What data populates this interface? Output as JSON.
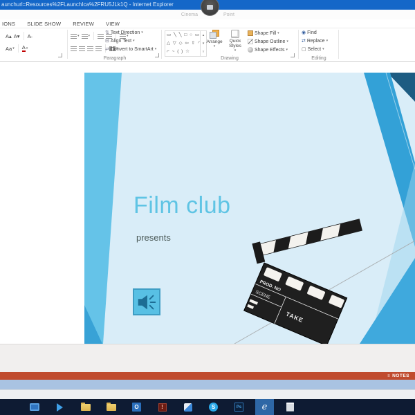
{
  "window": {
    "title": "aunchurl=Resources%2FLaunchIca%2FRU5JLk1Q - Internet Explorer"
  },
  "app_header": {
    "doc_title_left": "Cinema",
    "doc_title_right": "Point"
  },
  "ribbon": {
    "tabs": [
      {
        "label": "IONS"
      },
      {
        "label": "SLIDE SHOW"
      },
      {
        "label": "REVIEW"
      },
      {
        "label": "VIEW"
      }
    ],
    "font_group": {
      "grow": "A▴",
      "shrink": "A▾",
      "clear": "A̶",
      "change_case": "Aa",
      "font_color": "A"
    },
    "paragraph_group": {
      "label": "Paragraph",
      "text_direction": "Text Direction",
      "align_text": "Align Text",
      "smartart": "Convert to SmartArt"
    },
    "drawing_group": {
      "label": "Drawing",
      "shape_row_1": "▭ ╲ ╲ □ ○ ▭",
      "shape_row_2": "△ ▽ ◇ ⇦ ⇧ ◠",
      "shape_row_3": "⌐ ~ ( ) ☆",
      "arrange": "Arrange",
      "quick_styles": "Quick Styles",
      "shape_fill": "Shape Fill",
      "shape_outline": "Shape Outline",
      "shape_effects": "Shape Effects"
    },
    "editing_group": {
      "label": "Editing",
      "find": "Find",
      "replace": "Replace",
      "select": "Select"
    }
  },
  "slide": {
    "title": "Film club",
    "subtitle": "presents",
    "clapperboard": {
      "prod_no": "PROD. NO",
      "scene": "SCENE",
      "take": "TAKE"
    }
  },
  "status_bar": {
    "notes": "NOTES"
  },
  "taskbar": {
    "icons": [
      {
        "name": "monitor"
      },
      {
        "name": "media-player"
      },
      {
        "name": "folder-1"
      },
      {
        "name": "folder-2"
      },
      {
        "name": "outlook",
        "glyph": "O"
      },
      {
        "name": "alert",
        "glyph": "!"
      },
      {
        "name": "flag"
      },
      {
        "name": "skype",
        "glyph": "S"
      },
      {
        "name": "photoshop",
        "glyph": "Ps"
      },
      {
        "name": "internet-explorer",
        "glyph": "e",
        "active": true
      },
      {
        "name": "notepad"
      }
    ]
  },
  "icons": {
    "caret": "▾",
    "gallery_up": "▴",
    "gallery_down": "▾",
    "gallery_more": "▿",
    "find": "◉",
    "replace": "⇄",
    "select": "▢",
    "text_direction": "⇅",
    "align_text": "⊟",
    "smartart": "⇄",
    "notes": "≡"
  },
  "colors": {
    "titlebar": "#1467c8",
    "status_bar": "#c04b2e",
    "slide_bg": "#d9edf8",
    "slide_band_left": "#65c3e8",
    "slide_band_mid": "#33a1d7",
    "slide_band_dark": "#1d5c82",
    "slide_band_bottom": "#3fa9dd",
    "slide_title_text": "#5fc4e4",
    "slide_subtitle_text": "#4d5c5a",
    "window_strip": "#a9c3e2",
    "taskbar": "#0e1b33"
  }
}
